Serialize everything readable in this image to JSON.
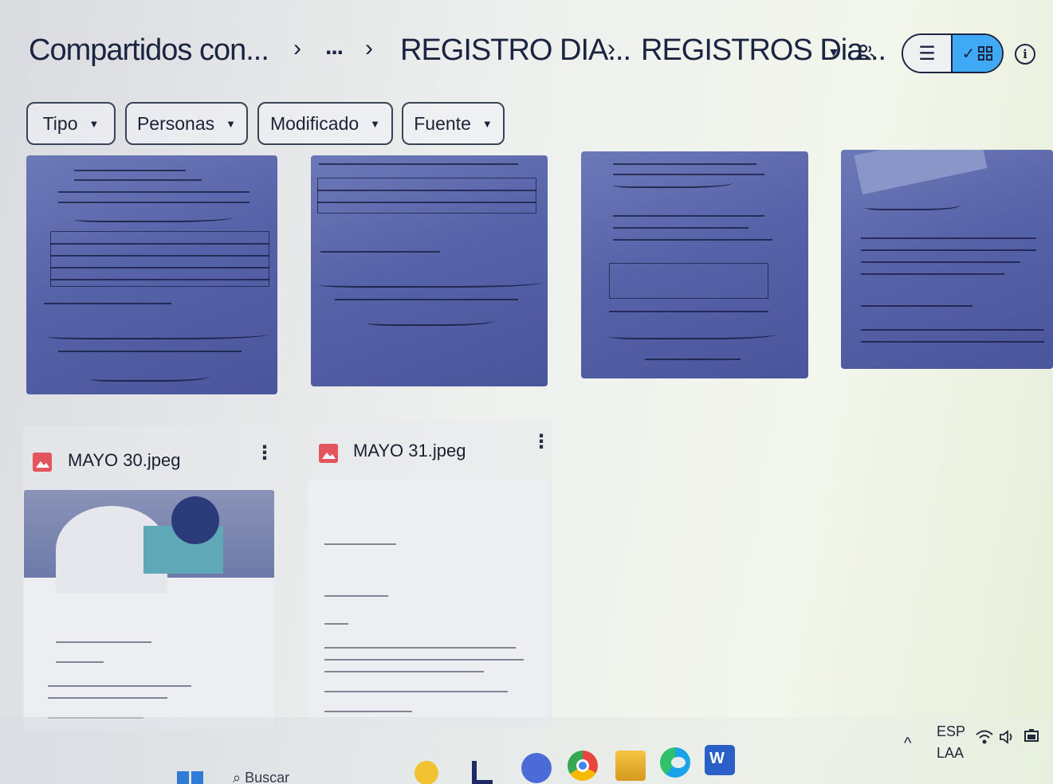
{
  "breadcrumb": {
    "items": [
      "Compartidos con...",
      "...",
      "REGISTRO DIA...",
      "REGISTROS Dia..."
    ],
    "separator": "›"
  },
  "view": {
    "list_icon": "list-icon",
    "grid_icon": "grid-icon",
    "grid_selected": true,
    "check_glyph": "✓",
    "list_glyph": "☰",
    "info_glyph": "i",
    "people_icon": "people-icon"
  },
  "filters": [
    {
      "label": "Tipo"
    },
    {
      "label": "Personas"
    },
    {
      "label": "Modificado"
    },
    {
      "label": "Fuente"
    }
  ],
  "files": [
    {
      "name": "MAYO 30.jpeg",
      "icon": "image-file-icon"
    },
    {
      "name": "MAYO 31.jpeg",
      "icon": "image-file-icon"
    }
  ],
  "taskbar": {
    "search_text": "Buscar",
    "language": "ESP",
    "layout": "LAA",
    "tray_up": "^",
    "apps": [
      "windows-start-icon",
      "search-icon",
      "task-view-icon",
      "file-explorer-icon",
      "teams-icon",
      "chrome-icon",
      "folder-icon",
      "edge-icon",
      "word-icon"
    ]
  },
  "colors": {
    "accent": "#3fa9f5",
    "thumb_tint": "#5763a8",
    "image_icon": "#e3545f"
  }
}
